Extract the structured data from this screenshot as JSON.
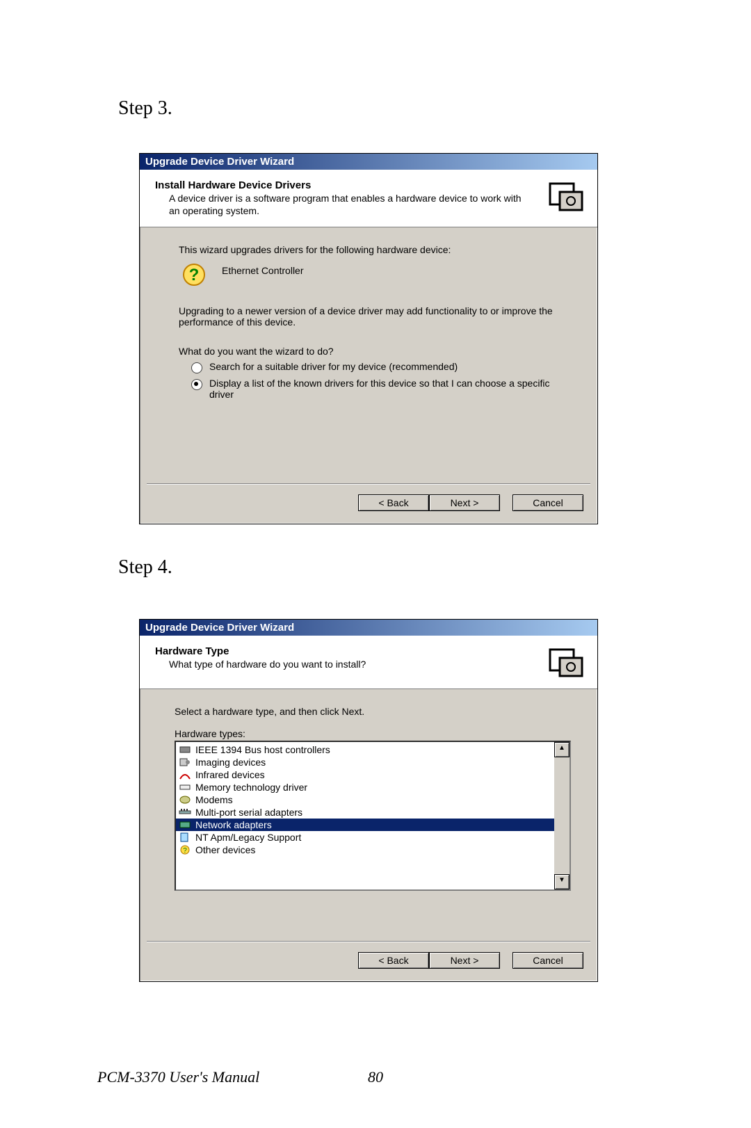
{
  "step3_label": "Step 3.",
  "step4_label": "Step 4.",
  "dialog1": {
    "title": "Upgrade Device Driver Wizard",
    "header_title": "Install Hardware Device Drivers",
    "header_sub": "A device driver is a software program that enables a hardware device to work with an operating system.",
    "line1": "This wizard upgrades drivers for the following hardware device:",
    "device_name": "Ethernet Controller",
    "line2": "Upgrading to a newer version of a device driver may add functionality to or improve the performance of this device.",
    "question": "What do you want the wizard to do?",
    "opt1": "Search for a suitable driver for my device (recommended)",
    "opt2": "Display a list of the known drivers for this device so that I can choose a specific driver",
    "back": "< Back",
    "next": "Next >",
    "cancel": "Cancel"
  },
  "dialog2": {
    "title": "Upgrade Device Driver Wizard",
    "header_title": "Hardware Type",
    "header_sub": "What type of hardware do you want to install?",
    "instruction": "Select a hardware type, and then click Next.",
    "list_label": "Hardware types:",
    "items": [
      "IEEE 1394 Bus host controllers",
      "Imaging devices",
      "Infrared devices",
      "Memory technology driver",
      "Modems",
      "Multi-port serial adapters",
      "Network adapters",
      "NT Apm/Legacy Support",
      "Other devices"
    ],
    "selected_index": 6,
    "back": "< Back",
    "next": "Next >",
    "cancel": "Cancel"
  },
  "footer": {
    "manual": "PCM-3370 User's Manual",
    "page": "80"
  }
}
